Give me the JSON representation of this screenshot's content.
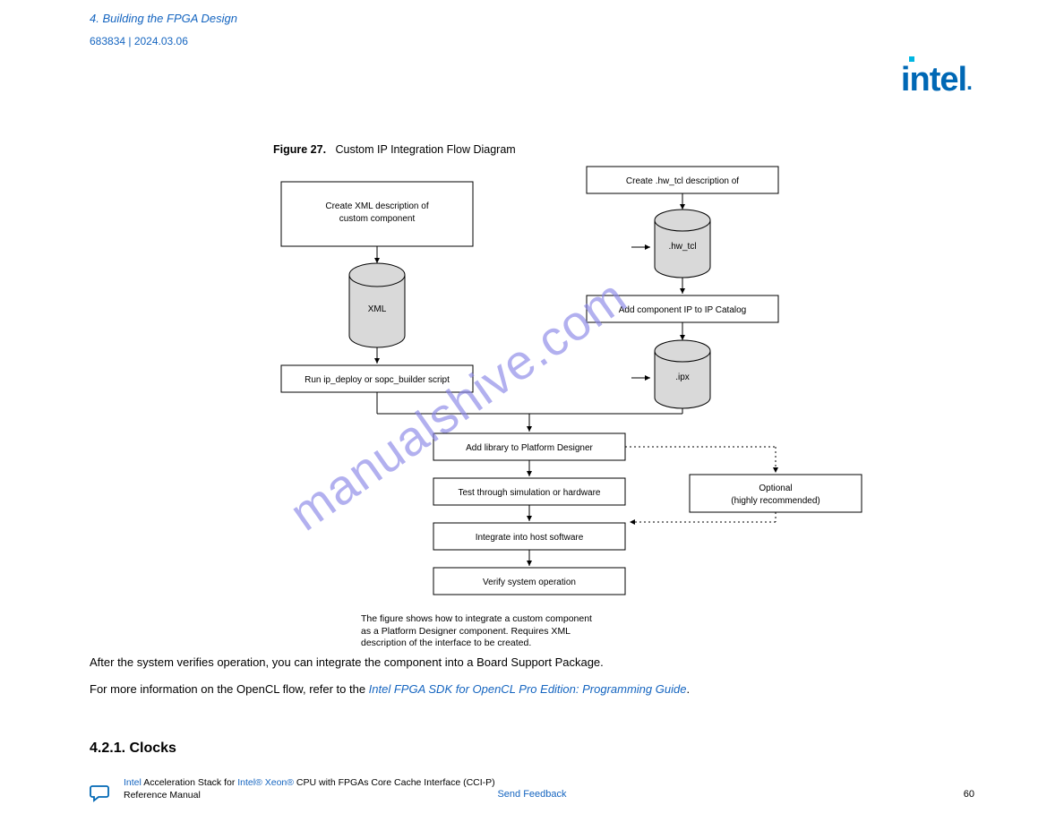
{
  "header": {
    "breadcrumb_part1": "4. Building the FPGA Design",
    "breadcrumb_part2": "683834 | 2024.03.06",
    "doc_id": "683834 | 2024.03.06",
    "send_feedback": "Send Feedback"
  },
  "logo": {
    "text": "intel"
  },
  "figure": {
    "number": "Figure 27.",
    "title": "Custom IP Integration Flow Diagram",
    "nodes": {
      "create_xml": "Create XML description of\ncustom component",
      "hw_tcl": ".hw_tcl",
      "add_ip": "Add component IP to IP Catalog",
      "xml": "XML",
      "run_script": "Run ip_deploy or sopc_builder script",
      "ipx": ".ipx",
      "add_library": "Add library to Platform Designer",
      "test_sim": "Test through simulation or hardware",
      "optional": "Optional\n(highly recommended)",
      "integrate": "Integrate into host software",
      "verify": "Verify system operation"
    },
    "caption": "The figure shows how to integrate a custom component as a Platform Designer component.  Requires XML description of the interface to be created."
  },
  "body": {
    "p1": "After the system verifies operation, you can integrate the component into a Board Support Package.",
    "p2_pre": "For more information on the OpenCL flow, refer to the ",
    "p2_link": "Intel FPGA SDK for OpenCL Pro Edition: Programming Guide",
    "p2_post": "."
  },
  "section": {
    "heading": "4.2.1. Clocks"
  },
  "footer": {
    "left_line1_brand": "Intel",
    "left_line1_brand_suffix": " Acceleration Stack for ",
    "left_line1_brand2": "Intel® Xeon®",
    "left_line1_rest": " CPU with FPGAs Core Cache Interface (CCI-P)",
    "left_line2": "Reference Manual",
    "center": "Send Feedback",
    "right": "60"
  },
  "watermark": "manualshive.com"
}
